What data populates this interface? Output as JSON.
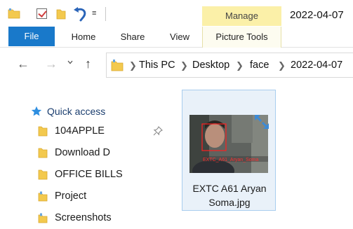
{
  "window": {
    "title": "2022-04-07"
  },
  "ribbon": {
    "contextual_group": "Manage",
    "tabs": [
      "File",
      "Home",
      "Share",
      "View",
      "Picture Tools"
    ]
  },
  "address": {
    "crumbs": [
      "This PC",
      "Desktop",
      "face",
      "2022-04-07"
    ]
  },
  "navpane": {
    "quick_access": "Quick access",
    "items": [
      "104APPLE",
      "Download D",
      "OFFICE BILLS",
      "Project",
      "Screenshots"
    ]
  },
  "content": {
    "files": [
      {
        "name_line1": "EXTC A61 Aryan",
        "name_line2": "Soma.jpg",
        "thumb_caption": "EXTC_A61_Aryan_Soma"
      }
    ]
  },
  "colors": {
    "file_tab": "#1979ca",
    "manage_tab": "#fbf0a8",
    "folder": "#f3c94e",
    "selected_tile": "#e9f1f9",
    "selected_border": "#a8cdee",
    "quick_access_star": "#2e8ee0",
    "face_box": "#ff1f1f"
  },
  "icons": [
    "folder-icon",
    "checkbox-icon",
    "undo-icon",
    "pin-icon",
    "star-icon",
    "up-arrow-icon",
    "back-arrow-icon",
    "forward-arrow-icon"
  ]
}
